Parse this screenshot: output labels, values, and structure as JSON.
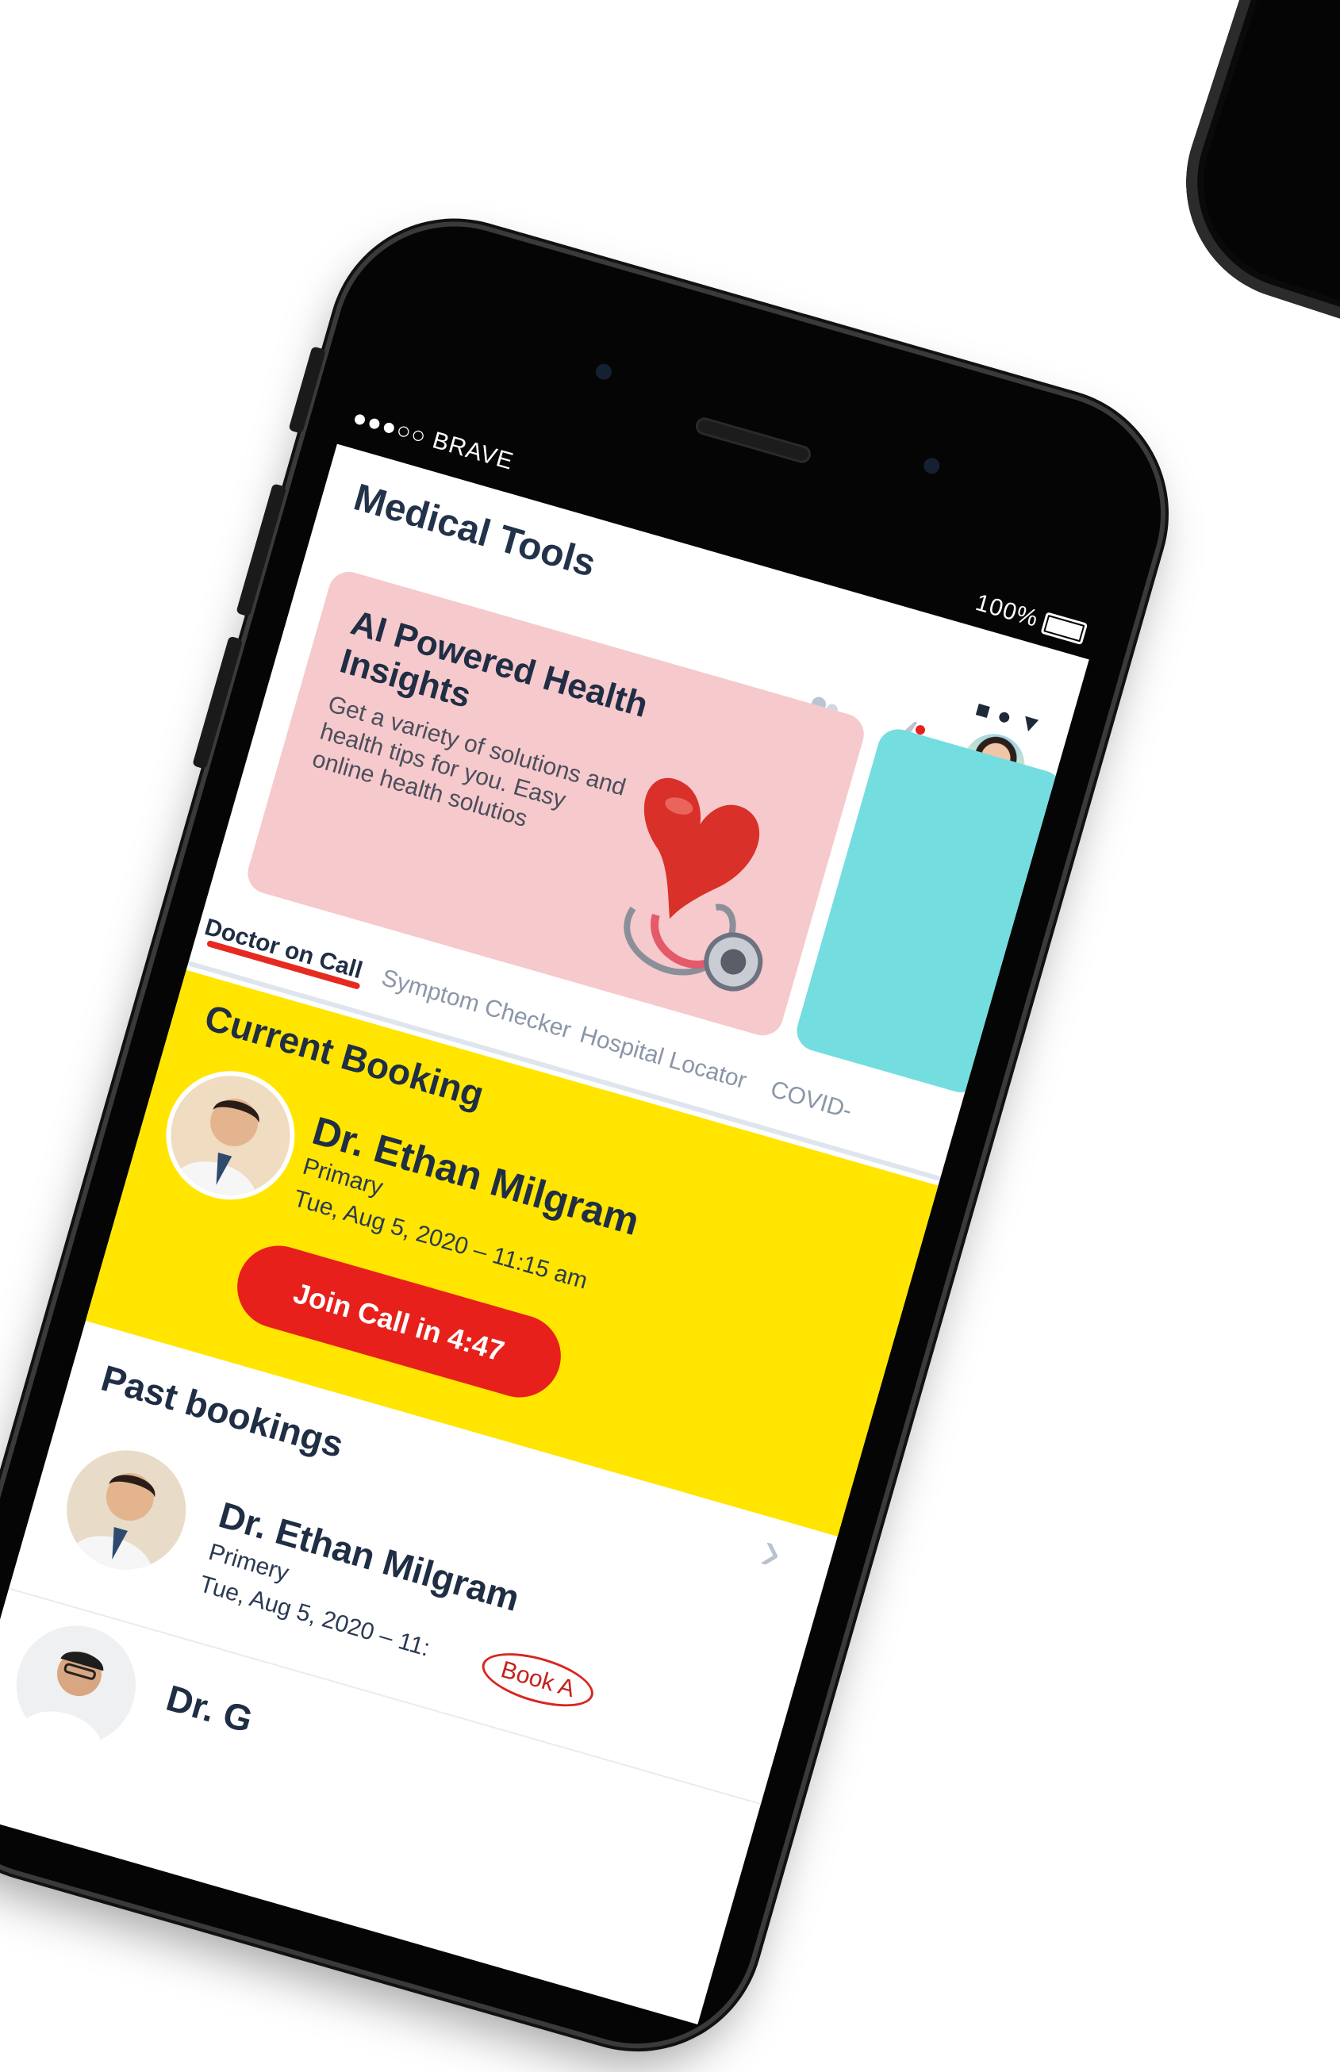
{
  "status_bar": {
    "carrier": "●●●○○ BRAVE",
    "battery": "100%"
  },
  "header": {
    "title": "Medical Tools",
    "nav_shapes": "■●▼"
  },
  "banner": {
    "title": "AI Powered Health Insights",
    "description": "Get a variety of solutions and health tips for you. Easy online health solutios"
  },
  "tabs": [
    {
      "label": "Doctor on Call",
      "active": true
    },
    {
      "label": "Symptom Checker",
      "active": false
    },
    {
      "label": "Hospital Locator",
      "active": false
    },
    {
      "label": "COVID-",
      "active": false
    }
  ],
  "current_booking": {
    "section_title": "Current Booking",
    "doctor_name": "Dr. Ethan Milgram",
    "specialty": "Primary",
    "datetime": "Tue, Aug 5, 2020 – 11:15 am",
    "join_label": "Join Call in 4:47"
  },
  "past_bookings": {
    "section_title": "Past bookings",
    "items": [
      {
        "doctor_name": "Dr. Ethan Milgram",
        "specialty": "Primery",
        "datetime": "Tue, Aug 5, 2020 – 11:",
        "action": "Book A"
      },
      {
        "doctor_name": "Dr. G"
      }
    ]
  },
  "colors": {
    "accent_red": "#e8201b",
    "highlight_yellow": "#ffe500",
    "banner_pink": "#f6c9cc",
    "teal_card": "#74dde0",
    "text_dark": "#1f2e45"
  }
}
